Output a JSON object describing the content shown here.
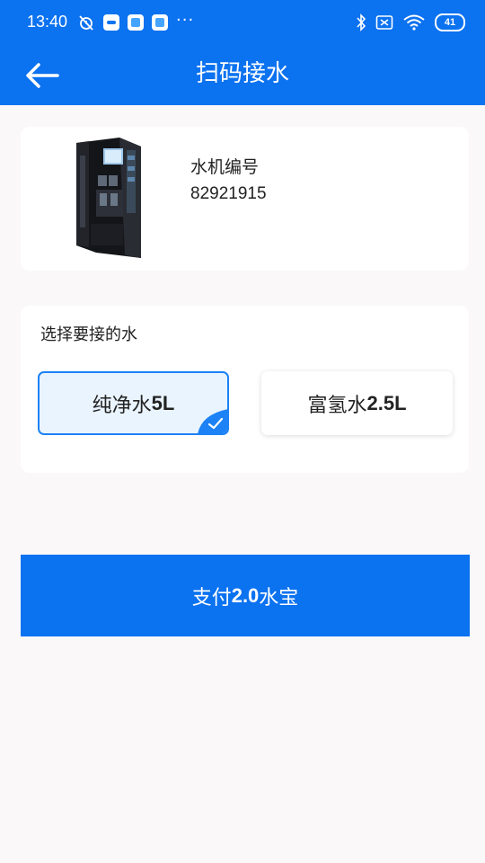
{
  "status_bar": {
    "time": "13:40",
    "battery": "41",
    "left_icons": [
      "alarm-off-icon",
      "app-notification-icon",
      "app-notification-icon",
      "app-notification-icon",
      "more-dots-icon"
    ],
    "right_icons": [
      "bluetooth-icon",
      "sim-off-icon",
      "wifi-icon",
      "battery-icon"
    ],
    "more": "···"
  },
  "header": {
    "title": "扫码接水",
    "back_icon": "arrow-left-icon",
    "background": "#0b72f0"
  },
  "machine": {
    "label": "水机编号",
    "number": "82921915",
    "image": "water-dispenser-machine-image"
  },
  "selection": {
    "title": "选择要接的水",
    "options": [
      {
        "name": "纯净水",
        "amount": "5L",
        "selected": true
      },
      {
        "name": "富氢水",
        "amount": "2.5L",
        "selected": false
      }
    ],
    "accent": "#1c82f5"
  },
  "pay_button": {
    "prefix": "支付",
    "amount": "2.0",
    "suffix": "水宝",
    "background": "#0b72f0"
  }
}
